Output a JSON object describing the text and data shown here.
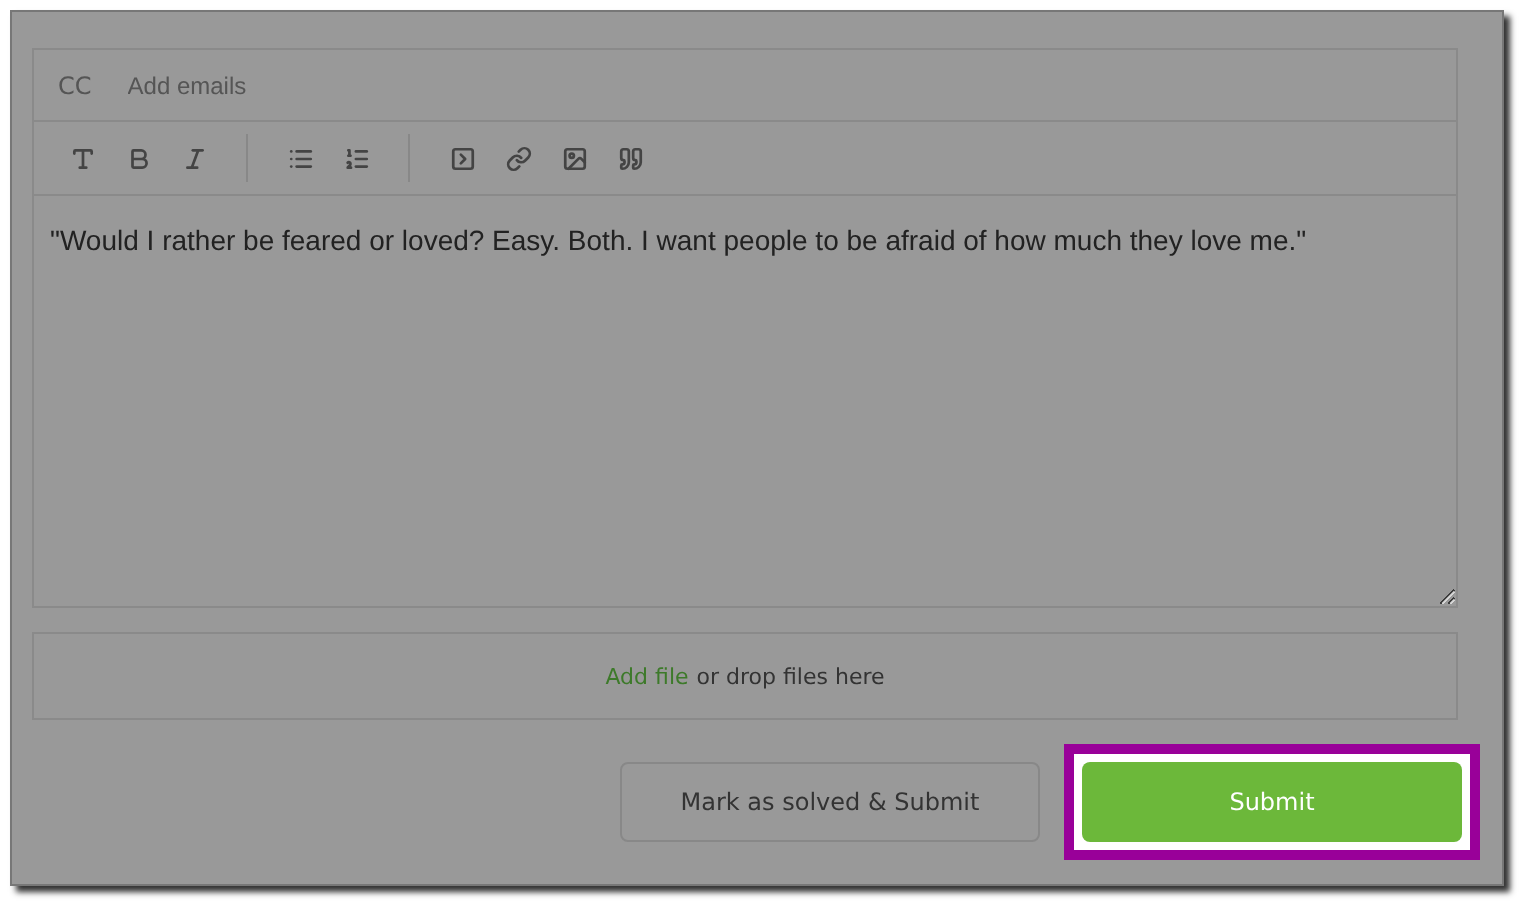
{
  "cc": {
    "label": "CC",
    "placeholder": "Add emails"
  },
  "editor": {
    "value": "\"Would I rather be feared or loved? Easy. Both. I want people to be afraid of how much they love me.\""
  },
  "attach": {
    "link": "Add file",
    "text": "or drop files here"
  },
  "buttons": [
    {
      "label": "Mark as solved & Submit",
      "kind": "secondary",
      "highlighted": false
    },
    {
      "label": "Submit",
      "kind": "primary",
      "highlighted": true
    }
  ]
}
